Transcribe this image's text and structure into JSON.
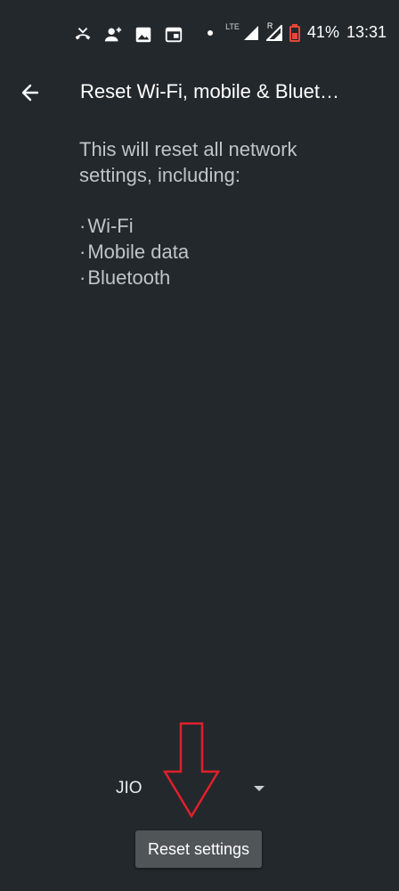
{
  "status_bar": {
    "icons_left": [
      "missed-call-icon",
      "add-contact-icon",
      "image-icon",
      "calendar-icon"
    ],
    "network": "LTE",
    "sim2_label": "R",
    "battery_percent": "41%",
    "time": "13:31"
  },
  "app_bar": {
    "title": "Reset Wi-Fi, mobile & Bluet…"
  },
  "content": {
    "intro": "This will reset all network settings, including:",
    "items": [
      "Wi-Fi",
      "Mobile data",
      "Bluetooth"
    ]
  },
  "carrier_selector": {
    "value": "JIO"
  },
  "actions": {
    "reset_label": "Reset settings"
  },
  "colors": {
    "background": "#23282c",
    "annotation_arrow": "#e0202a"
  }
}
